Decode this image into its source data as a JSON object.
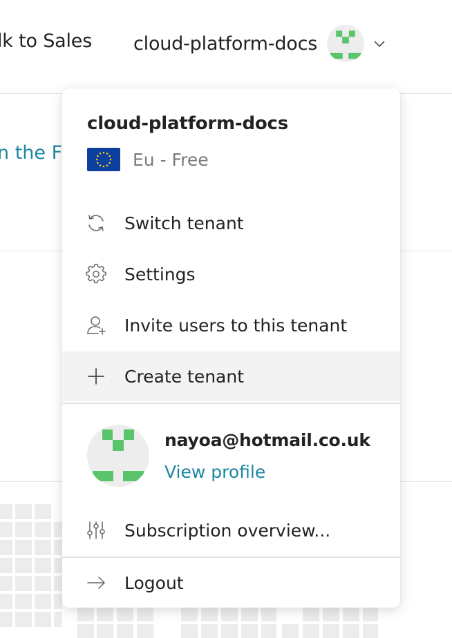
{
  "header": {
    "talk_to_sales": "lk to Sales",
    "tenant_name": "cloud-platform-docs",
    "avatar_icon": "pixel-avatar-icon",
    "chevron_icon": "chevron-down-icon"
  },
  "background": {
    "link_text": "n the F"
  },
  "dropdown": {
    "title": "cloud-platform-docs",
    "region": "Eu - Free",
    "flag_icon": "eu-flag-icon",
    "items": [
      {
        "label": "Switch tenant",
        "icon": "switch-icon"
      },
      {
        "label": "Settings",
        "icon": "gear-icon"
      },
      {
        "label": "Invite users to this tenant",
        "icon": "add-user-icon"
      },
      {
        "label": "Create tenant",
        "icon": "plus-icon"
      }
    ],
    "profile": {
      "email": "nayoa@hotmail.co.uk",
      "view_profile": "View profile"
    },
    "subscription": {
      "label": "Subscription overview...",
      "icon": "sliders-icon"
    },
    "logout": {
      "label": "Logout",
      "icon": "arrow-right-icon"
    }
  },
  "colors": {
    "link": "#1c86a3",
    "avatar_green": "#5ac46a",
    "hover_bg": "#f3f3f3",
    "eu_blue": "#0d3f9e",
    "eu_star": "#f5cf19"
  }
}
